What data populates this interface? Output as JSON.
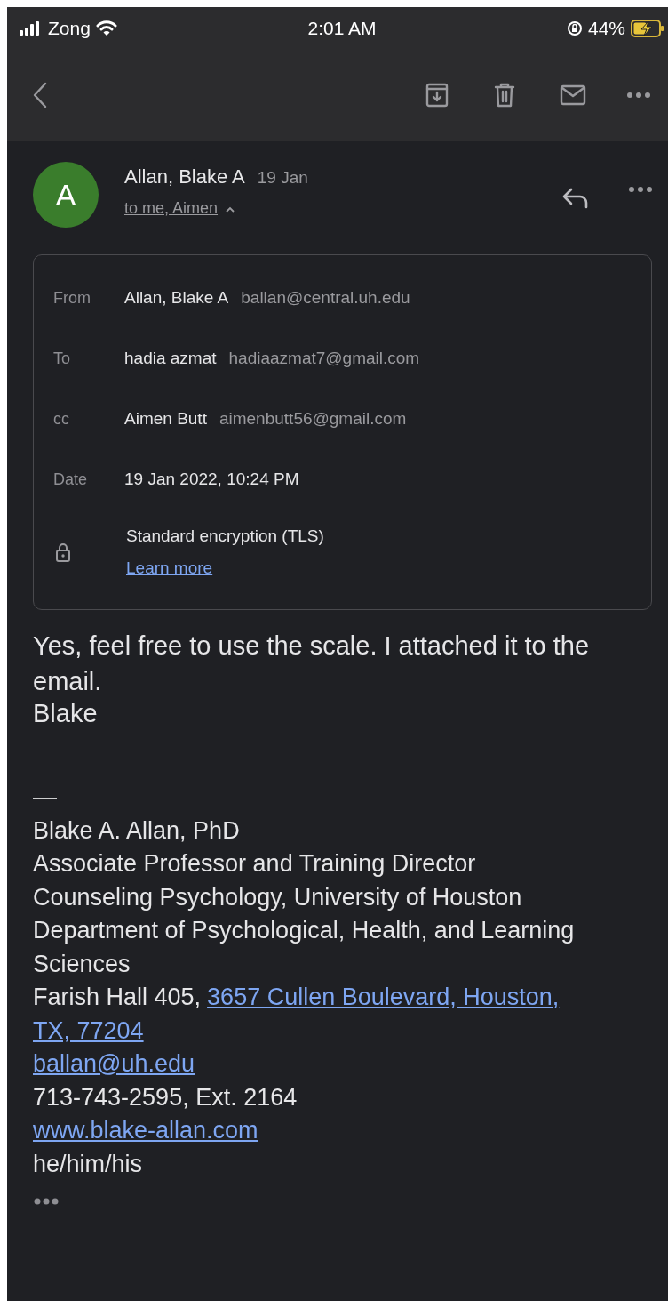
{
  "status_bar": {
    "carrier": "Zong",
    "time": "2:01 AM",
    "battery": "44%",
    "charging": true
  },
  "message": {
    "sender": "Allan, Blake A",
    "avatar": "A",
    "date": "19 Jan",
    "recipients": "to me, Aimen",
    "expanded": true,
    "details": [
      {
        "label": "From",
        "name": "Allan, Blake A",
        "email": "ballan@central.uh.edu"
      },
      {
        "label": "To",
        "name": "hadia azmat",
        "email": "hadiaazmat7@gmail.com"
      },
      {
        "label": "cc",
        "name": "Aimen Butt",
        "email": "aimenbutt56@gmail.com"
      },
      {
        "label": "Date",
        "name": "19 Jan 2022, 10:24 PM"
      }
    ],
    "encryption": {
      "text": "Standard encryption (TLS)",
      "link": "Learn more"
    },
    "body": [
      "Yes, feel free to use the scale. I attached it to the email.",
      "Blake"
    ],
    "signature": [
      [
        {
          "text": "—"
        }
      ],
      [
        {
          "text": "Blake A. Allan, PhD"
        }
      ],
      [
        {
          "text": "Associate Professor and Training Director"
        }
      ],
      [
        {
          "text": "Counseling Psychology, University of Houston"
        }
      ],
      [
        {
          "text": "Department of Psychological, Health, and Learning Sciences"
        }
      ],
      [
        {
          "text": "Farish Hall 405,"
        },
        {
          "text": "3657 Cullen Boulevard, Houston,",
          "link": true
        }
      ],
      [
        {
          "text": "TX, 77204",
          "link": true
        }
      ],
      [
        {
          "text": "ballan@uh.edu",
          "link": true
        }
      ],
      [
        {
          "text": "713-743-2595, Ext. 2164"
        }
      ],
      [
        {
          "text": "www.blake-allan.com",
          "link": true
        }
      ],
      [
        {
          "text": "he/him/his"
        }
      ]
    ],
    "trimmed": true
  }
}
